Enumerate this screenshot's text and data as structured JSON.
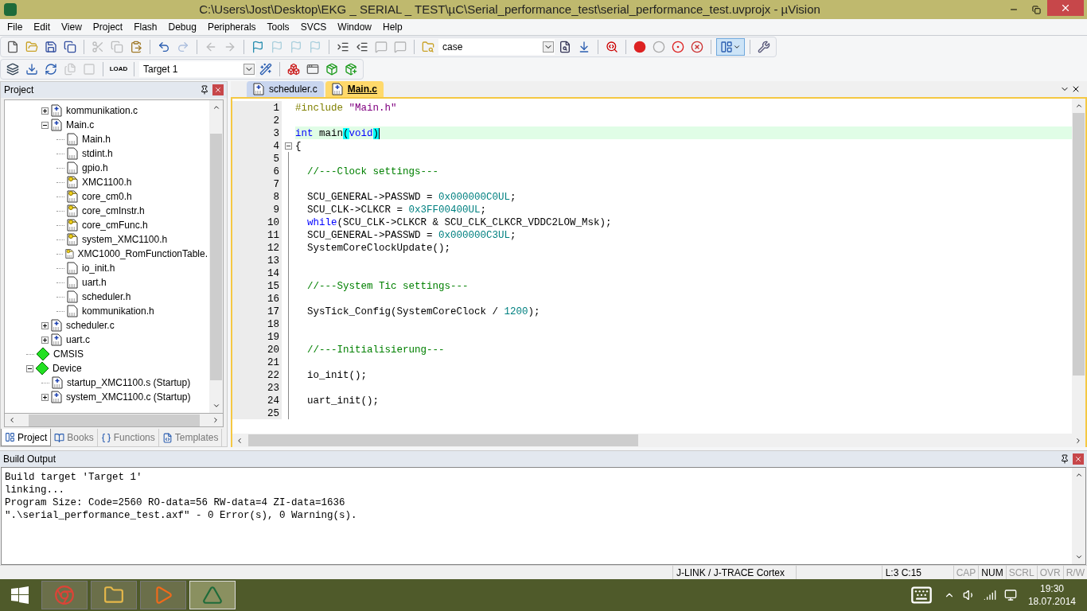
{
  "window": {
    "title": "C:\\Users\\Jost\\Desktop\\EKG _ SERIAL _ TEST\\µC\\Serial_performance_test\\serial_performance_test.uvprojx - µVision"
  },
  "menu": [
    "File",
    "Edit",
    "View",
    "Project",
    "Flash",
    "Debug",
    "Peripherals",
    "Tools",
    "SVCS",
    "Window",
    "Help"
  ],
  "toolbar_1": [
    {
      "kind": "new",
      "disabled": false
    },
    {
      "kind": "open",
      "disabled": false
    },
    {
      "kind": "save",
      "disabled": false
    },
    {
      "kind": "save-all",
      "disabled": false
    },
    {
      "kind": "sep"
    },
    {
      "kind": "cut",
      "disabled": true
    },
    {
      "kind": "copy",
      "disabled": true
    },
    {
      "kind": "paste",
      "disabled": false
    },
    {
      "kind": "sep"
    },
    {
      "kind": "undo",
      "disabled": false
    },
    {
      "kind": "redo",
      "disabled": true
    },
    {
      "kind": "sep"
    },
    {
      "kind": "back",
      "disabled": true
    },
    {
      "kind": "forward",
      "disabled": true
    },
    {
      "kind": "sep"
    },
    {
      "kind": "bookmark",
      "disabled": false
    },
    {
      "kind": "bookmark",
      "disabled": true
    },
    {
      "kind": "bookmark",
      "disabled": true
    },
    {
      "kind": "bookmark",
      "disabled": true
    },
    {
      "kind": "sep"
    },
    {
      "kind": "indent",
      "disabled": false
    },
    {
      "kind": "unindent",
      "disabled": false
    },
    {
      "kind": "comment",
      "disabled": true
    },
    {
      "kind": "comment",
      "disabled": true
    },
    {
      "kind": "sep"
    },
    {
      "kind": "find-files",
      "disabled": false
    },
    {
      "kind": "combo",
      "value": "case"
    },
    {
      "kind": "find",
      "disabled": false
    },
    {
      "kind": "jump",
      "disabled": false
    },
    {
      "kind": "sep"
    },
    {
      "kind": "debug",
      "disabled": false
    },
    {
      "kind": "sep"
    },
    {
      "kind": "breakpoint",
      "disabled": false
    },
    {
      "kind": "breakpoint-off",
      "disabled": false
    },
    {
      "kind": "breakpoints-toggle",
      "disabled": false
    },
    {
      "kind": "breakpoints-kill",
      "disabled": false
    },
    {
      "kind": "sep"
    },
    {
      "kind": "layout",
      "disabled": false,
      "selected": true
    },
    {
      "kind": "sep"
    },
    {
      "kind": "settings",
      "disabled": false
    }
  ],
  "toolbar_2": [
    {
      "kind": "translate",
      "disabled": false
    },
    {
      "kind": "build",
      "disabled": false
    },
    {
      "kind": "rebuild",
      "disabled": false
    },
    {
      "kind": "batch",
      "disabled": true
    },
    {
      "kind": "stop",
      "disabled": true
    },
    {
      "kind": "sep"
    },
    {
      "kind": "load",
      "label": "LOAD",
      "disabled": false
    },
    {
      "kind": "sep"
    },
    {
      "kind": "combo",
      "value": "Target 1"
    },
    {
      "kind": "options",
      "disabled": false
    },
    {
      "kind": "sep"
    },
    {
      "kind": "components",
      "disabled": false
    },
    {
      "kind": "windows",
      "disabled": false
    },
    {
      "kind": "pack",
      "disabled": false
    },
    {
      "kind": "pack-installer",
      "disabled": false
    }
  ],
  "project_panel": {
    "title": "Project",
    "source_files": [
      {
        "name": "kommunikation.c",
        "kind": "c-file",
        "expanded": false
      },
      {
        "name": "Main.c",
        "kind": "c-file",
        "expanded": true,
        "children": [
          {
            "name": "Main.h",
            "kind": "header"
          },
          {
            "name": "stdint.h",
            "kind": "header"
          },
          {
            "name": "gpio.h",
            "kind": "header"
          },
          {
            "name": "XMC1100.h",
            "kind": "system-header"
          },
          {
            "name": "core_cm0.h",
            "kind": "system-header"
          },
          {
            "name": "core_cmInstr.h",
            "kind": "system-header"
          },
          {
            "name": "core_cmFunc.h",
            "kind": "system-header"
          },
          {
            "name": "system_XMC1100.h",
            "kind": "system-header"
          },
          {
            "name": "XMC1000_RomFunctionTable.",
            "kind": "system-header"
          },
          {
            "name": "io_init.h",
            "kind": "header"
          },
          {
            "name": "uart.h",
            "kind": "header"
          },
          {
            "name": "scheduler.h",
            "kind": "header"
          },
          {
            "name": "kommunikation.h",
            "kind": "header"
          }
        ]
      },
      {
        "name": "scheduler.c",
        "kind": "c-file",
        "expanded": false
      },
      {
        "name": "uart.c",
        "kind": "c-file",
        "expanded": false
      }
    ],
    "groups": [
      {
        "name": "CMSIS",
        "kind": "component"
      },
      {
        "name": "Device",
        "kind": "component",
        "expanded": true,
        "children": [
          {
            "name": "startup_XMC1100.s (Startup)",
            "kind": "c-file"
          },
          {
            "name": "system_XMC1100.c (Startup)",
            "kind": "c-file",
            "expanded": false
          }
        ]
      }
    ],
    "tabs": [
      {
        "label": "Project",
        "kind": "project",
        "selected": true
      },
      {
        "label": "Books",
        "kind": "books",
        "selected": false
      },
      {
        "label": "Functions",
        "kind": "functions",
        "selected": false
      },
      {
        "label": "Templates",
        "kind": "templates",
        "selected": false
      }
    ]
  },
  "editor": {
    "tabs": [
      {
        "label": "scheduler.c",
        "selected": false
      },
      {
        "label": "Main.c",
        "selected": true
      }
    ],
    "lines": [
      {
        "n": "1",
        "current": false,
        "fold": false,
        "tokens": [
          {
            "t": "#include ",
            "kind": "pre"
          },
          {
            "t": "\"Main.h\"",
            "kind": "str"
          }
        ]
      },
      {
        "n": "2",
        "current": false,
        "fold": false
      },
      {
        "n": "3",
        "current": true,
        "fold": false,
        "tokens": [
          {
            "t": "int",
            "kind": "kw"
          },
          {
            "t": " main",
            "kind": "plain"
          },
          {
            "t": "(",
            "kind": "match"
          },
          {
            "t": "void",
            "kind": "kw"
          },
          {
            "t": ")",
            "kind": "match"
          }
        ]
      },
      {
        "n": "4",
        "current": false,
        "fold": true,
        "tokens": [
          {
            "t": "{",
            "kind": "plain"
          }
        ]
      },
      {
        "n": "5",
        "current": false,
        "fold": false
      },
      {
        "n": "6",
        "current": false,
        "fold": false,
        "tokens": [
          {
            "t": "  //---Clock settings---",
            "kind": "cmt"
          }
        ]
      },
      {
        "n": "7",
        "current": false,
        "fold": false
      },
      {
        "n": "8",
        "current": false,
        "fold": false,
        "tokens": [
          {
            "t": "  SCU_GENERAL->PASSWD = ",
            "kind": "plain"
          },
          {
            "t": "0x000000C0UL",
            "kind": "num"
          },
          {
            "t": ";",
            "kind": "plain"
          }
        ]
      },
      {
        "n": "9",
        "current": false,
        "fold": false,
        "tokens": [
          {
            "t": "  SCU_CLK->CLKCR = ",
            "kind": "plain"
          },
          {
            "t": "0x3FF00400UL",
            "kind": "num"
          },
          {
            "t": ";",
            "kind": "plain"
          }
        ]
      },
      {
        "n": "10",
        "current": false,
        "fold": false,
        "tokens": [
          {
            "t": "  while",
            "kind": "kw"
          },
          {
            "t": "(SCU_CLK->CLKCR & SCU_CLK_CLKCR_VDDC2LOW_Msk);",
            "kind": "plain"
          }
        ]
      },
      {
        "n": "11",
        "current": false,
        "fold": false,
        "tokens": [
          {
            "t": "  SCU_GENERAL->PASSWD = ",
            "kind": "plain"
          },
          {
            "t": "0x000000C3UL",
            "kind": "num"
          },
          {
            "t": ";",
            "kind": "plain"
          }
        ]
      },
      {
        "n": "12",
        "current": false,
        "fold": false,
        "tokens": [
          {
            "t": "  SystemCoreClockUpdate();",
            "kind": "plain"
          }
        ]
      },
      {
        "n": "13",
        "current": false,
        "fold": false
      },
      {
        "n": "14",
        "current": false,
        "fold": false
      },
      {
        "n": "15",
        "current": false,
        "fold": false,
        "tokens": [
          {
            "t": "  //---System Tic settings---",
            "kind": "cmt"
          }
        ]
      },
      {
        "n": "16",
        "current": false,
        "fold": false
      },
      {
        "n": "17",
        "current": false,
        "fold": false,
        "tokens": [
          {
            "t": "  SysTick_Config(SystemCoreClock / ",
            "kind": "plain"
          },
          {
            "t": "1200",
            "kind": "num"
          },
          {
            "t": ");",
            "kind": "plain"
          }
        ]
      },
      {
        "n": "18",
        "current": false,
        "fold": false
      },
      {
        "n": "19",
        "current": false,
        "fold": false
      },
      {
        "n": "20",
        "current": false,
        "fold": false,
        "tokens": [
          {
            "t": "  //---Initialisierung---",
            "kind": "cmt"
          }
        ]
      },
      {
        "n": "21",
        "current": false,
        "fold": false
      },
      {
        "n": "22",
        "current": false,
        "fold": false,
        "tokens": [
          {
            "t": "  io_init();",
            "kind": "plain"
          }
        ]
      },
      {
        "n": "23",
        "current": false,
        "fold": false
      },
      {
        "n": "24",
        "current": false,
        "fold": false,
        "tokens": [
          {
            "t": "  uart_init();",
            "kind": "plain"
          }
        ]
      },
      {
        "n": "25",
        "current": false,
        "fold": false
      }
    ]
  },
  "build_output": {
    "title": "Build Output",
    "lines": [
      "Build target 'Target 1'",
      "linking...",
      "Program Size: Code=2560 RO-data=56 RW-data=4 ZI-data=1636",
      "\".\\serial_performance_test.axf\" - 0 Error(s), 0 Warning(s)."
    ]
  },
  "status_bar": {
    "debugger": "J-LINK / J-TRACE Cortex",
    "position": "L:3 C:15",
    "indicators": [
      {
        "label": "CAP",
        "on": false
      },
      {
        "label": "NUM",
        "on": true
      },
      {
        "label": "SCRL",
        "on": false
      },
      {
        "label": "OVR",
        "on": false
      },
      {
        "label": "R/W",
        "on": false
      }
    ]
  },
  "taskbar": {
    "apps": [
      {
        "kind": "browser",
        "selected": false
      },
      {
        "kind": "explorer",
        "selected": false
      },
      {
        "kind": "media",
        "selected": false
      },
      {
        "kind": "uvision",
        "selected": true
      }
    ],
    "time": "19:30",
    "date": "18.07.2014"
  }
}
